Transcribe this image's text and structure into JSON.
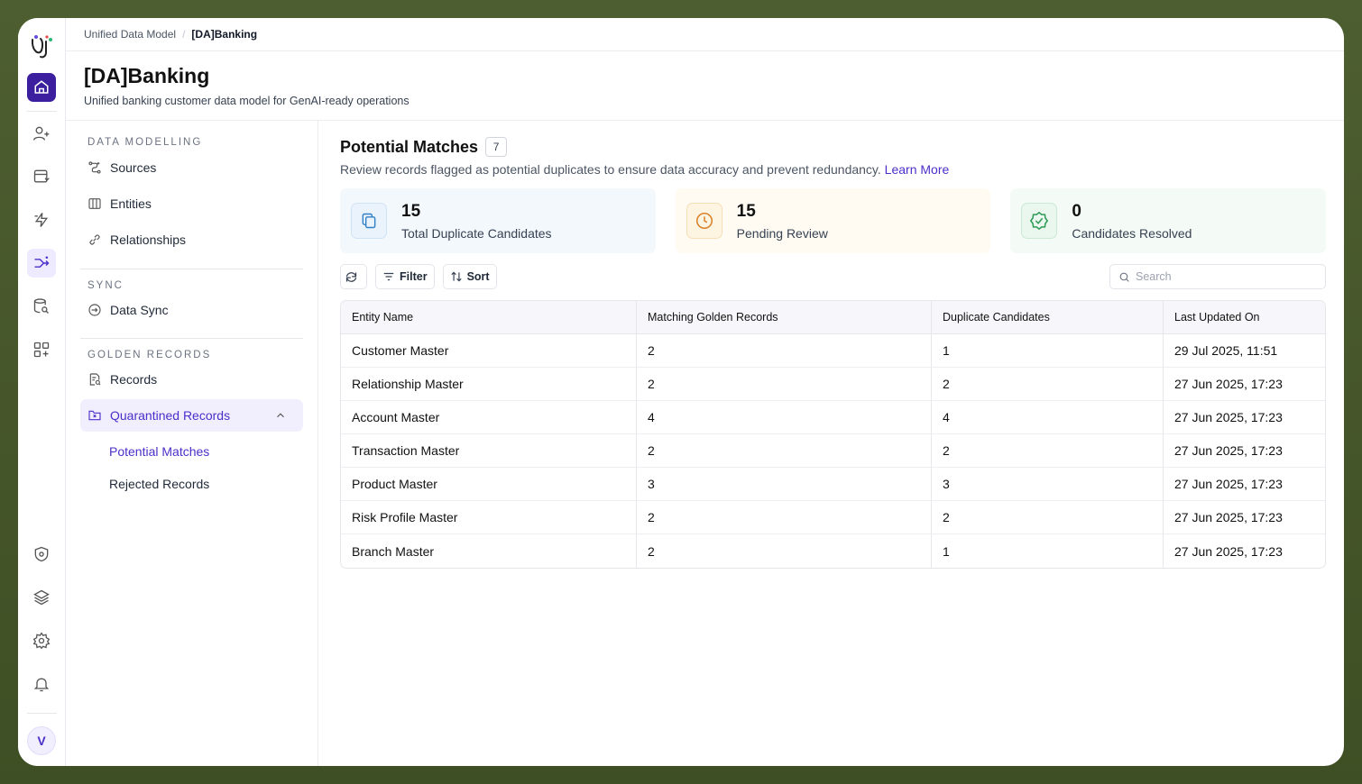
{
  "breadcrumb": {
    "parent": "Unified Data Model",
    "current": "[DA]Banking"
  },
  "header": {
    "title": "[DA]Banking",
    "subtitle": "Unified banking customer data model for GenAI-ready operations"
  },
  "user": {
    "initial": "V"
  },
  "nav": {
    "data_modelling": {
      "heading": "DATA MODELLING",
      "items": [
        {
          "label": "Sources",
          "icon": "sources-icon"
        },
        {
          "label": "Entities",
          "icon": "entities-icon"
        },
        {
          "label": "Relationships",
          "icon": "link-icon"
        }
      ]
    },
    "sync": {
      "heading": "SYNC",
      "items": [
        {
          "label": "Data Sync",
          "icon": "sync-icon"
        }
      ]
    },
    "golden_records": {
      "heading": "GOLDEN RECORDS",
      "records_label": "Records",
      "quarantined_label": "Quarantined Records",
      "sub_items": [
        "Potential Matches",
        "Rejected Records"
      ]
    }
  },
  "main": {
    "title": "Potential Matches",
    "count": "7",
    "description": "Review records flagged as potential duplicates to ensure data accuracy and prevent redundancy.",
    "learn_more": "Learn More",
    "stats": [
      {
        "value": "15",
        "label": "Total Duplicate Candidates",
        "color": "#2f80c6"
      },
      {
        "value": "15",
        "label": "Pending Review",
        "color": "#d9822b"
      },
      {
        "value": "0",
        "label": "Candidates Resolved",
        "color": "#2e9b57"
      }
    ],
    "toolbar": {
      "filter": "Filter",
      "sort": "Sort",
      "search_placeholder": "Search"
    },
    "table": {
      "columns": [
        "Entity Name",
        "Matching Golden Records",
        "Duplicate Candidates",
        "Last Updated On"
      ],
      "rows": [
        [
          "Customer Master",
          "2",
          "1",
          "29 Jul 2025, 11:51"
        ],
        [
          "Relationship Master",
          "2",
          "2",
          "27 Jun 2025, 17:23"
        ],
        [
          "Account Master",
          "4",
          "4",
          "27 Jun 2025, 17:23"
        ],
        [
          "Transaction Master",
          "2",
          "2",
          "27 Jun 2025, 17:23"
        ],
        [
          "Product Master",
          "3",
          "3",
          "27 Jun 2025, 17:23"
        ],
        [
          "Risk Profile Master",
          "2",
          "2",
          "27 Jun 2025, 17:23"
        ],
        [
          "Branch Master",
          "2",
          "1",
          "27 Jun 2025, 17:23"
        ]
      ]
    }
  },
  "colors": {
    "accent": "#4c2fc9",
    "rail_active": "#3b1f9e"
  }
}
